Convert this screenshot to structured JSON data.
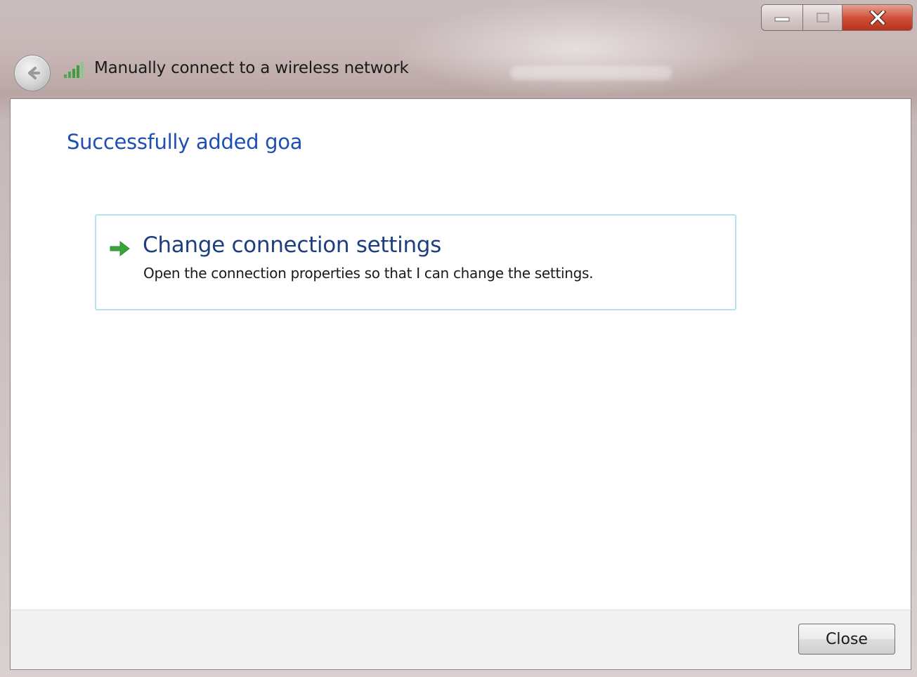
{
  "window": {
    "title": "Manually connect to a wireless network"
  },
  "icons": {
    "back": "back-arrow-icon",
    "network": "wireless-signal-icon",
    "option": "green-arrow-icon",
    "minimize": "minimize-icon",
    "maximize": "maximize-icon",
    "close": "close-icon"
  },
  "main": {
    "heading": "Successfully added goa",
    "option": {
      "title": "Change connection settings",
      "description": "Open the connection properties so that I can change the settings."
    }
  },
  "footer": {
    "close_label": "Close"
  },
  "colors": {
    "heading": "#1e4fb4",
    "option_title": "#1d3f7f",
    "option_border": "#b6e1f3",
    "arrow_green": "#3aa33a",
    "close_caption": "#c83a22"
  }
}
